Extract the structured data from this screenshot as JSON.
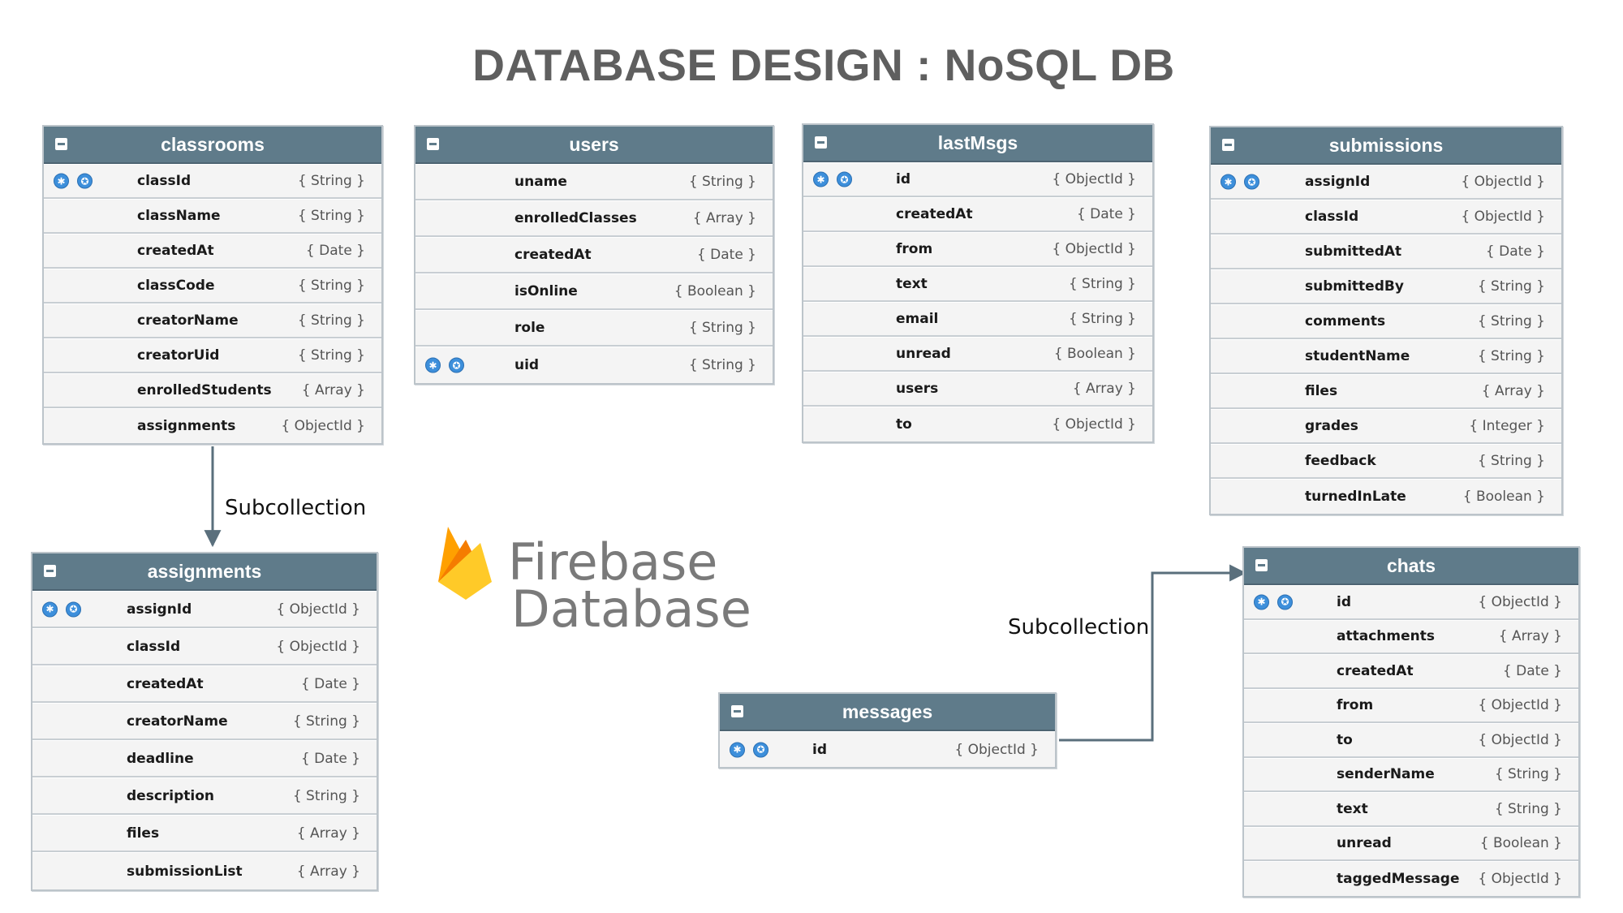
{
  "title": "DATABASE DESIGN : NoSQL DB",
  "labels": {
    "subcollection_left": "Subcollection",
    "subcollection_right": "Subcollection"
  },
  "logo": {
    "line1": "Firebase",
    "line2": "Database",
    "icon": "firebase-flame-icon",
    "colors": [
      "#FFA000",
      "#F57C00",
      "#FFCA28"
    ]
  },
  "colors": {
    "header": "#5f7b8a",
    "row": "#f4f4f4",
    "key": "#3d8fdb",
    "connector": "#5a6f7c"
  },
  "tables": {
    "classrooms": {
      "name": "classrooms",
      "fields": [
        {
          "name": "classId",
          "type": "{ String }",
          "key": true
        },
        {
          "name": "className",
          "type": "{ String }",
          "key": false
        },
        {
          "name": "createdAt",
          "type": "{ Date }",
          "key": false
        },
        {
          "name": "classCode",
          "type": "{ String }",
          "key": false
        },
        {
          "name": "creatorName",
          "type": "{ String }",
          "key": false
        },
        {
          "name": "creatorUid",
          "type": "{ String }",
          "key": false
        },
        {
          "name": "enrolledStudents",
          "type": "{ Array }",
          "key": false
        },
        {
          "name": "assignments",
          "type": "{ ObjectId }",
          "key": false
        }
      ]
    },
    "users": {
      "name": "users",
      "fields": [
        {
          "name": "uname",
          "type": "{ String }",
          "key": false
        },
        {
          "name": "enrolledClasses",
          "type": "{ Array }",
          "key": false
        },
        {
          "name": "createdAt",
          "type": "{ Date }",
          "key": false
        },
        {
          "name": "isOnline",
          "type": "{ Boolean }",
          "key": false
        },
        {
          "name": "role",
          "type": "{ String }",
          "key": false
        },
        {
          "name": "uid",
          "type": "{ String }",
          "key": true
        }
      ]
    },
    "lastMsgs": {
      "name": "lastMsgs",
      "fields": [
        {
          "name": "id",
          "type": "{ ObjectId }",
          "key": true
        },
        {
          "name": "createdAt",
          "type": "{ Date }",
          "key": false
        },
        {
          "name": "from",
          "type": "{ ObjectId }",
          "key": false
        },
        {
          "name": "text",
          "type": "{ String }",
          "key": false
        },
        {
          "name": "email",
          "type": "{ String }",
          "key": false
        },
        {
          "name": "unread",
          "type": "{ Boolean }",
          "key": false
        },
        {
          "name": "users",
          "type": "{ Array }",
          "key": false
        },
        {
          "name": "to",
          "type": "{ ObjectId }",
          "key": false
        }
      ]
    },
    "submissions": {
      "name": "submissions",
      "fields": [
        {
          "name": "assignId",
          "type": "{ ObjectId }",
          "key": true
        },
        {
          "name": "classId",
          "type": "{ ObjectId }",
          "key": false
        },
        {
          "name": "submittedAt",
          "type": "{ Date }",
          "key": false
        },
        {
          "name": "submittedBy",
          "type": "{ String }",
          "key": false
        },
        {
          "name": "comments",
          "type": "{ String }",
          "key": false
        },
        {
          "name": "studentName",
          "type": "{ String }",
          "key": false
        },
        {
          "name": "files",
          "type": "{ Array }",
          "key": false
        },
        {
          "name": "grades",
          "type": "{ Integer }",
          "key": false
        },
        {
          "name": "feedback",
          "type": "{ String }",
          "key": false
        },
        {
          "name": "turnedInLate",
          "type": "{ Boolean }",
          "key": false
        }
      ]
    },
    "assignments": {
      "name": "assignments",
      "fields": [
        {
          "name": "assignId",
          "type": "{ ObjectId }",
          "key": true
        },
        {
          "name": "classId",
          "type": "{ ObjectId }",
          "key": false
        },
        {
          "name": "createdAt",
          "type": "{ Date }",
          "key": false
        },
        {
          "name": "creatorName",
          "type": "{ String }",
          "key": false
        },
        {
          "name": "deadline",
          "type": "{ Date }",
          "key": false
        },
        {
          "name": "description",
          "type": "{ String }",
          "key": false
        },
        {
          "name": "files",
          "type": "{ Array }",
          "key": false
        },
        {
          "name": "submissionList",
          "type": "{ Array }",
          "key": false
        }
      ]
    },
    "messages": {
      "name": "messages",
      "fields": [
        {
          "name": "id",
          "type": "{ ObjectId }",
          "key": true
        }
      ]
    },
    "chats": {
      "name": "chats",
      "fields": [
        {
          "name": "id",
          "type": "{ ObjectId }",
          "key": true
        },
        {
          "name": "attachments",
          "type": "{ Array }",
          "key": false
        },
        {
          "name": "createdAt",
          "type": "{ Date }",
          "key": false
        },
        {
          "name": "from",
          "type": "{ ObjectId }",
          "key": false
        },
        {
          "name": "to",
          "type": "{ ObjectId }",
          "key": false
        },
        {
          "name": "senderName",
          "type": "{ String }",
          "key": false
        },
        {
          "name": "text",
          "type": "{ String }",
          "key": false
        },
        {
          "name": "unread",
          "type": "{ Boolean }",
          "key": false
        },
        {
          "name": "taggedMessage",
          "type": "{ ObjectId }",
          "key": false
        }
      ]
    }
  }
}
